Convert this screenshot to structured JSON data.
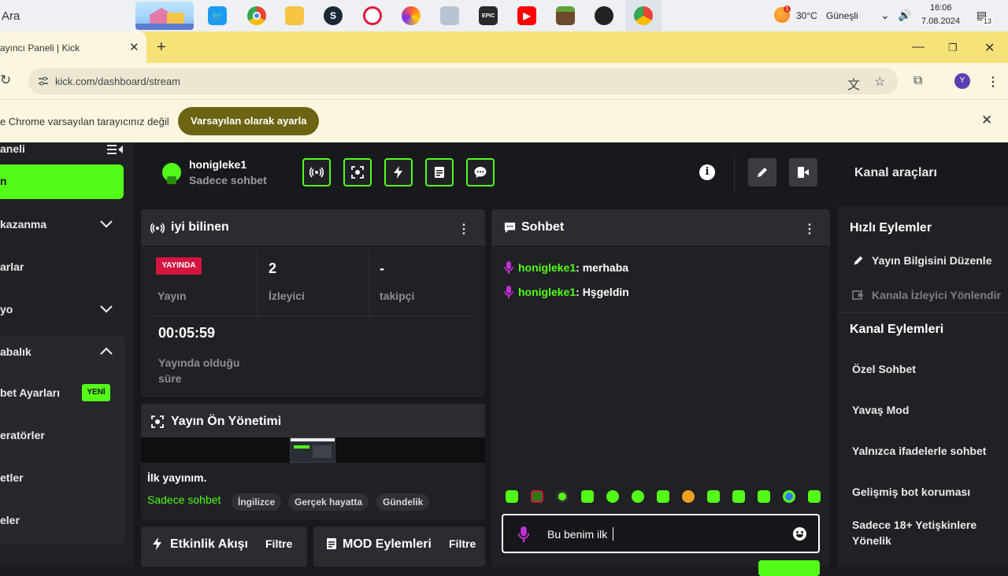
{
  "taskbar": {
    "search_label": "Ara",
    "weather_temp": "30°C",
    "weather_text": "Güneşli",
    "time": "16:06",
    "date": "7.08.2024",
    "notification_count": "13"
  },
  "browser": {
    "tab_title": "ayıncı Paneli | Kick",
    "url": "kick.com/dashboard/stream",
    "profile_initial": "Y",
    "default_msg": "e Chrome varsayılan tarayıcınız değil",
    "default_btn": "Varsayılan olarak ayarla"
  },
  "sidebar": {
    "title": "aneli",
    "active_item": "n",
    "items": [
      "kazanma",
      "arlar",
      "yo",
      "abalık",
      "bet Ayarları",
      "eratörler",
      "etler",
      "eler"
    ],
    "new_badge": "YENİ"
  },
  "header": {
    "username": "honigleke1",
    "mode": "Sadece sohbet",
    "channel_tools": "Kanal araçları"
  },
  "stream_panel": {
    "title": "iyi bilinen",
    "live_badge": "YAYINDA",
    "live_label": "Yayın",
    "viewers_value": "2",
    "viewers_label": "İzleyici",
    "followers_value": "-",
    "followers_label": "takipçi",
    "uptime_value": "00:05:59",
    "uptime_label": "Yayında olduğu süre"
  },
  "preview_panel": {
    "title": "Yayın Ön Yönetimi",
    "stream_title": "İlk yayınım.",
    "category": "Sadece sohbet",
    "tags": [
      "İngilizce",
      "Gerçek hayatta",
      "Gündelik"
    ]
  },
  "activity_panel": {
    "title": "Etkinlik Akışı",
    "filter": "Filtre"
  },
  "mod_panel": {
    "title": "MOD Eylemleri",
    "filter": "Filtre"
  },
  "chat": {
    "title": "Sohbet",
    "messages": [
      {
        "user": "honigleke1",
        "text": ": merhaba"
      },
      {
        "user": "honigleke1",
        "text": ": Hşgeldin"
      }
    ],
    "input_value": "Bu benim ilk"
  },
  "quick_actions": {
    "title": "Hızlı Eylemler",
    "items": [
      "Yayın Bilgisini Düzenle",
      "Kanala İzleyici Yönlendir"
    ]
  },
  "channel_actions": {
    "title": "Kanal Eylemleri",
    "items": [
      "Özel Sohbet",
      "Yavaş Mod",
      "Yalnızca ifadelerle sohbet",
      "Gelişmiş bot koruması",
      "Sadece 18+ Yetişkinlere Yönelik"
    ]
  },
  "colors": {
    "accent": "#53fc18",
    "live": "#d5143f",
    "mic": "#c42fd6"
  }
}
